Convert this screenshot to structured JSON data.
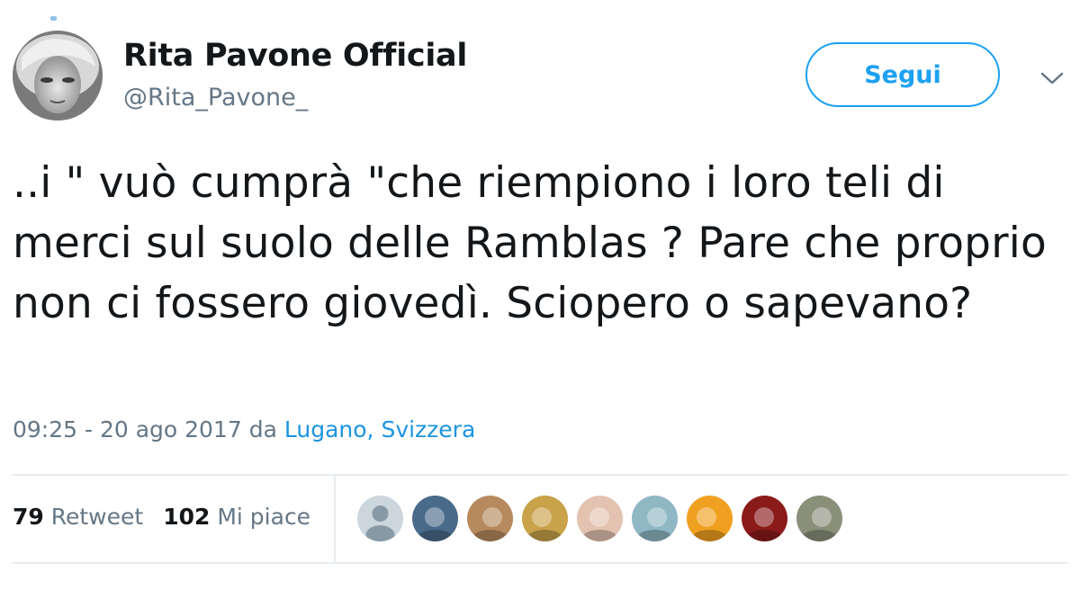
{
  "user": {
    "display_name": "Rita Pavone Official",
    "handle": "@Rita_Pavone_"
  },
  "follow_button": {
    "label": "Segui"
  },
  "tweet": {
    "text": "..i \" vuò cumprà \"che riempiono i loro teli di merci sul suolo delle Ramblas ? Pare che proprio non ci fossero giovedì. Sciopero o sapevano?",
    "timestamp": "09:25 - 20 ago 2017",
    "location_prefix": "da",
    "location": "Lugano, Svizzera"
  },
  "stats": {
    "retweet_count": "79",
    "retweet_label": "Retweet",
    "like_count": "102",
    "like_label": "Mi piace"
  },
  "likers": [
    {
      "icon": "default-avatar-icon",
      "color": "#ccd6dd"
    },
    {
      "icon": "avatar-photo",
      "color": "#4a6a8a"
    },
    {
      "icon": "avatar-photo",
      "color": "#b68a5e"
    },
    {
      "icon": "avatar-photo",
      "color": "#c9a24a"
    },
    {
      "icon": "avatar-photo",
      "color": "#e3c3b0"
    },
    {
      "icon": "avatar-photo",
      "color": "#8fb7c4"
    },
    {
      "icon": "avatar-photo",
      "color": "#f0a020"
    },
    {
      "icon": "avatar-photo",
      "color": "#8b1a1a"
    },
    {
      "icon": "avatar-photo",
      "color": "#8a8f7a"
    }
  ],
  "colors": {
    "accent": "#1da1f2",
    "link": "#1b95e0",
    "secondary_text": "#657786",
    "primary_text": "#14171a",
    "divider": "#e6ecf0"
  }
}
